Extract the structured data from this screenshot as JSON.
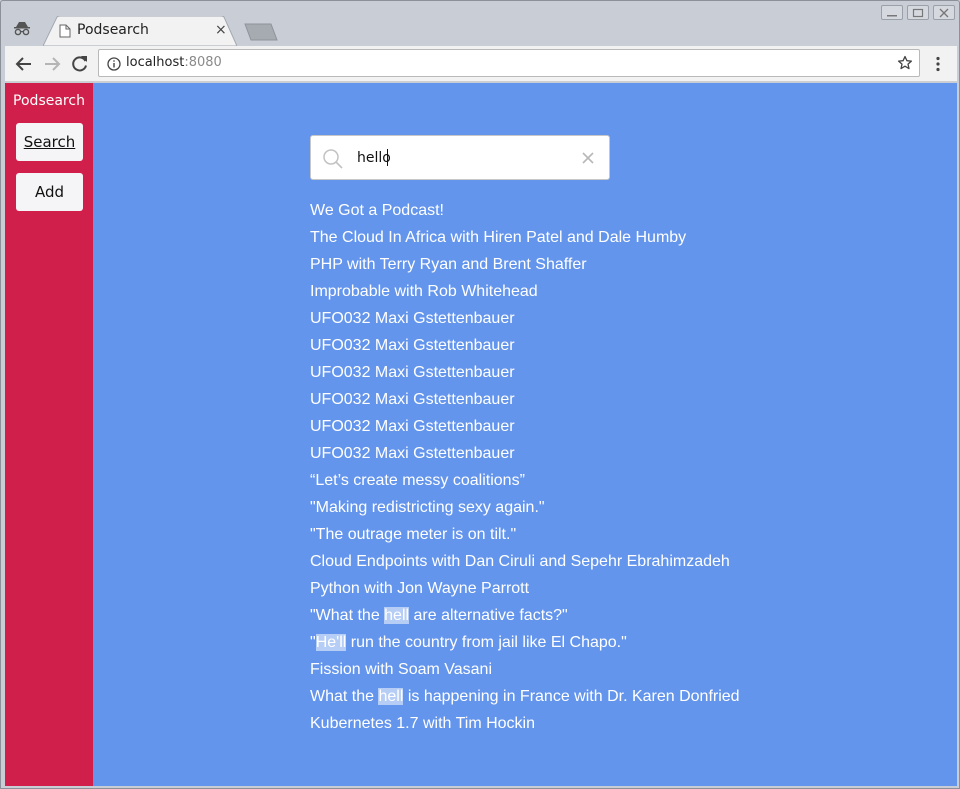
{
  "browser": {
    "tab_title": "Podsearch",
    "tab_close": "×",
    "url_host": "localhost",
    "url_port": ":8080"
  },
  "sidebar": {
    "brand": "Podsearch",
    "items": [
      {
        "label": "Search",
        "active": true
      },
      {
        "label": "Add",
        "active": false
      }
    ]
  },
  "search": {
    "value": "hello",
    "icon": "search-icon",
    "clear_icon": "close-icon"
  },
  "results": [
    {
      "parts": [
        {
          "text": "We Got a Podcast!"
        }
      ]
    },
    {
      "parts": [
        {
          "text": "The Cloud In Africa with Hiren Patel and Dale Humby"
        }
      ]
    },
    {
      "parts": [
        {
          "text": "PHP with Terry Ryan and Brent Shaffer"
        }
      ]
    },
    {
      "parts": [
        {
          "text": "Improbable with Rob Whitehead"
        }
      ]
    },
    {
      "parts": [
        {
          "text": "UFO032 Maxi Gstettenbauer"
        }
      ]
    },
    {
      "parts": [
        {
          "text": "UFO032 Maxi Gstettenbauer"
        }
      ]
    },
    {
      "parts": [
        {
          "text": "UFO032 Maxi Gstettenbauer"
        }
      ]
    },
    {
      "parts": [
        {
          "text": "UFO032 Maxi Gstettenbauer"
        }
      ]
    },
    {
      "parts": [
        {
          "text": "UFO032 Maxi Gstettenbauer"
        }
      ]
    },
    {
      "parts": [
        {
          "text": "UFO032 Maxi Gstettenbauer"
        }
      ]
    },
    {
      "parts": [
        {
          "text": "“Let’s create messy coalitions”"
        }
      ]
    },
    {
      "parts": [
        {
          "text": "\"Making redistricting sexy again.\""
        }
      ]
    },
    {
      "parts": [
        {
          "text": "\"The outrage meter is on tilt.\""
        }
      ]
    },
    {
      "parts": [
        {
          "text": "Cloud Endpoints with Dan Ciruli and Sepehr Ebrahimzadeh"
        }
      ]
    },
    {
      "parts": [
        {
          "text": "Python with Jon Wayne Parrott"
        }
      ]
    },
    {
      "parts": [
        {
          "text": "\"What the "
        },
        {
          "text": "hell",
          "hl": true
        },
        {
          "text": " are alternative facts?\""
        }
      ]
    },
    {
      "parts": [
        {
          "text": "\""
        },
        {
          "text": "He'll",
          "hl": true
        },
        {
          "text": " run the country from jail like El Chapo.\""
        }
      ]
    },
    {
      "parts": [
        {
          "text": "Fission with Soam Vasani"
        }
      ]
    },
    {
      "parts": [
        {
          "text": "What the "
        },
        {
          "text": "hell",
          "hl": true
        },
        {
          "text": " is happening in France with Dr. Karen Donfried"
        }
      ]
    },
    {
      "parts": [
        {
          "text": "Kubernetes 1.7 with Tim Hockin"
        }
      ]
    }
  ],
  "colors": {
    "page_bg": "#6495ed",
    "sidebar_bg": "#d01f4b",
    "highlight": "#b6cdf5"
  }
}
